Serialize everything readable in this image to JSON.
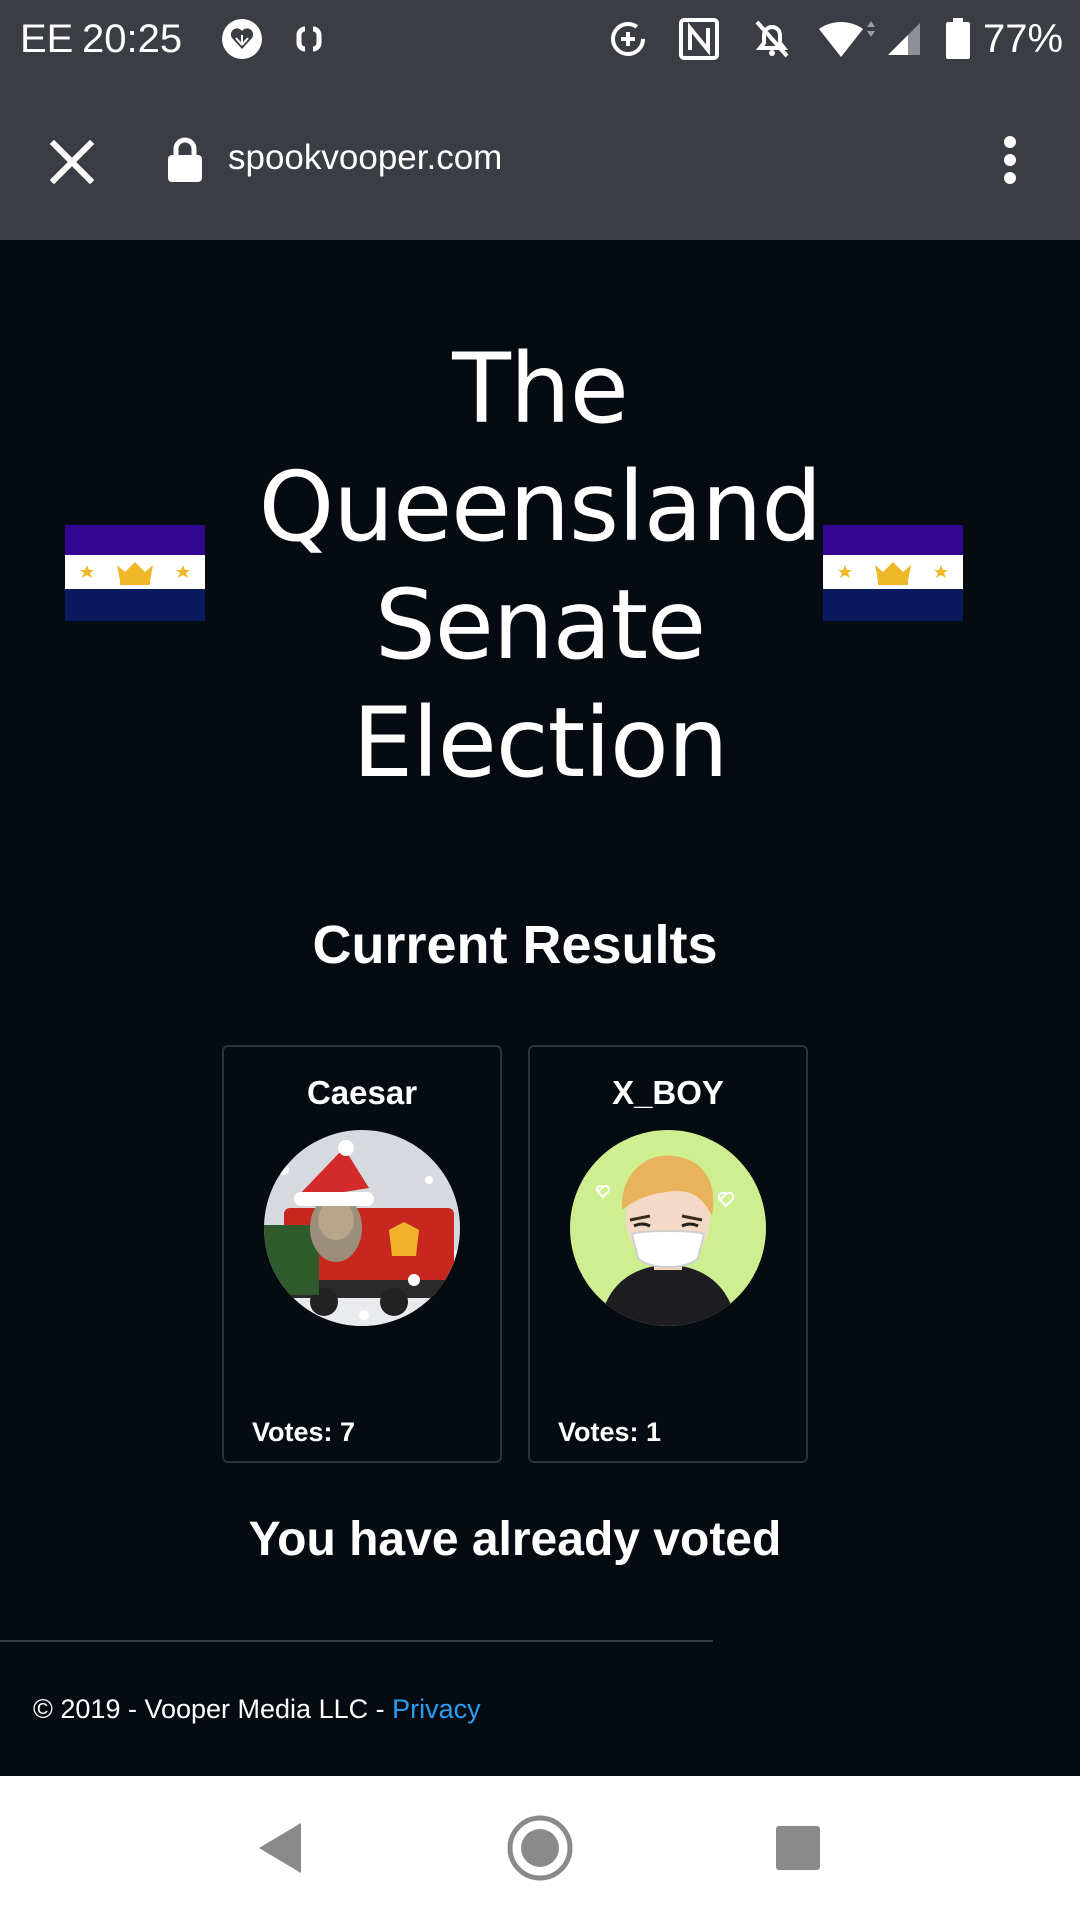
{
  "status_bar": {
    "carrier": "EE",
    "time": "20:25",
    "battery_percent": "77%",
    "icons": [
      "heart-app-icon",
      "sync-icon",
      "data-saver-icon",
      "nfc-icon",
      "notifications-off-icon",
      "wifi-icon",
      "signal-icon",
      "battery-icon"
    ]
  },
  "browser": {
    "url": "spookvooper.com",
    "close_icon": "close-icon",
    "menu_icon": "more-vert-icon",
    "secure_icon": "lock-icon"
  },
  "page": {
    "title_lines": [
      "The",
      "Queensland",
      "Senate",
      "Election"
    ],
    "flag_colors": {
      "top": "#34068f",
      "middle": "#ffffff",
      "bottom": "#0a1a5e",
      "emblem": "#f0b828"
    },
    "results_heading": "Current Results",
    "candidates": [
      {
        "name": "Caesar",
        "votes_label": "Votes: 7",
        "votes": 7
      },
      {
        "name": "X_BOY",
        "votes_label": "Votes: 1",
        "votes": 1
      }
    ],
    "voted_message": "You have already voted"
  },
  "footer": {
    "copyright": "© 2019 - Vooper Media LLC - ",
    "privacy_link": "Privacy",
    "link_color": "#2a9df4"
  },
  "nav_bar": {
    "buttons": [
      "back-icon",
      "home-icon",
      "recents-icon"
    ]
  },
  "colors": {
    "page_background": "#060b12",
    "chrome_background": "#3a3d44"
  }
}
